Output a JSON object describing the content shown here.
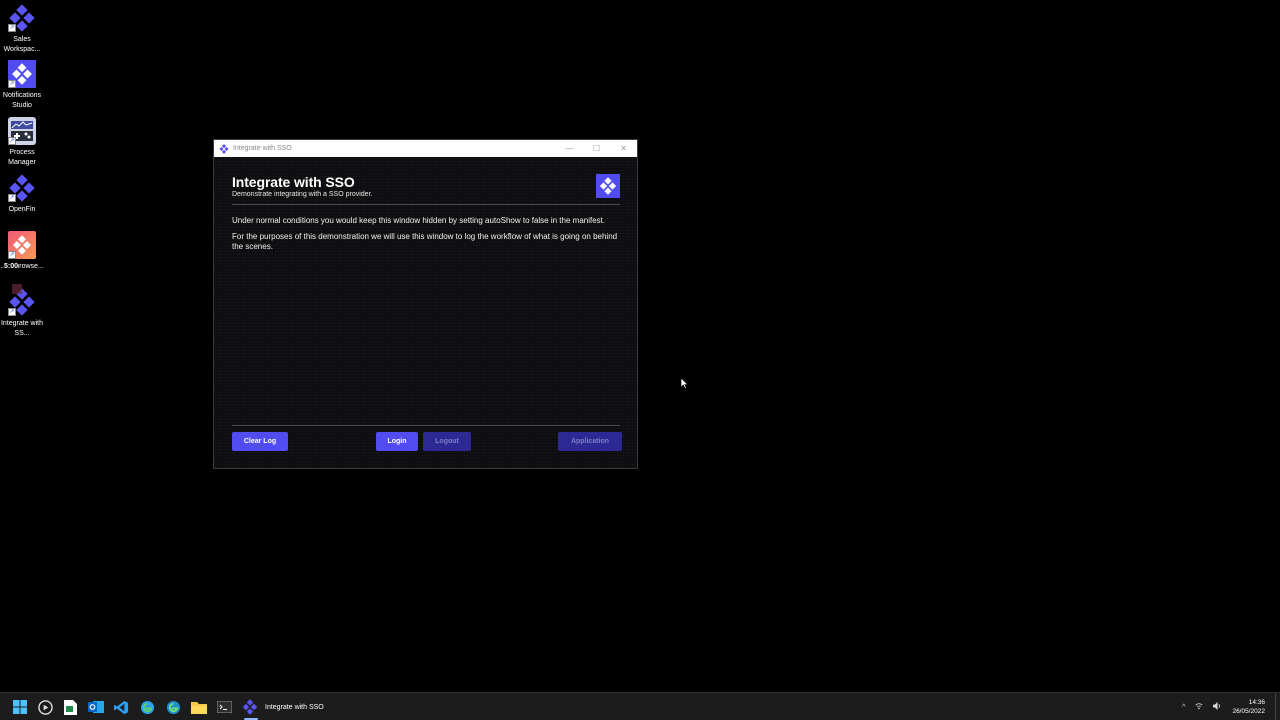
{
  "desktop": {
    "icons": [
      {
        "label": "Sales Workspac..."
      },
      {
        "label": "Notifications Studio"
      },
      {
        "label": "Process Manager"
      },
      {
        "label": "OpenFin"
      },
      {
        "label": "...ch browse..."
      },
      {
        "label": "Integrate with SS..."
      }
    ],
    "overlay_time": "5:00"
  },
  "window": {
    "title": "Integrate with SSO",
    "heading": "Integrate with SSO",
    "subheading": "Demonstrate integrating with a SSO provider.",
    "log": [
      "Under normal conditions you would keep this window hidden by setting autoShow to false in the manifest.",
      "For the purposes of this demonstration we will use this window to log the workflow of what is going on behind the scenes."
    ],
    "buttons": {
      "clear_log": "Clear Log",
      "login": "Login",
      "logout": "Logout",
      "application": "Application"
    },
    "controls": {
      "minimize": "—",
      "maximize": "☐",
      "close": "✕"
    }
  },
  "taskbar": {
    "active_app_label": "Integrate with SSO",
    "tray": {
      "chevron": "^",
      "time": "14:36",
      "date": "26/05/2022"
    }
  },
  "colors": {
    "accent": "#504cef",
    "accent_disabled": "#2c2994",
    "window_bg": "#0e0e10",
    "desktop_bg": "#000000"
  }
}
